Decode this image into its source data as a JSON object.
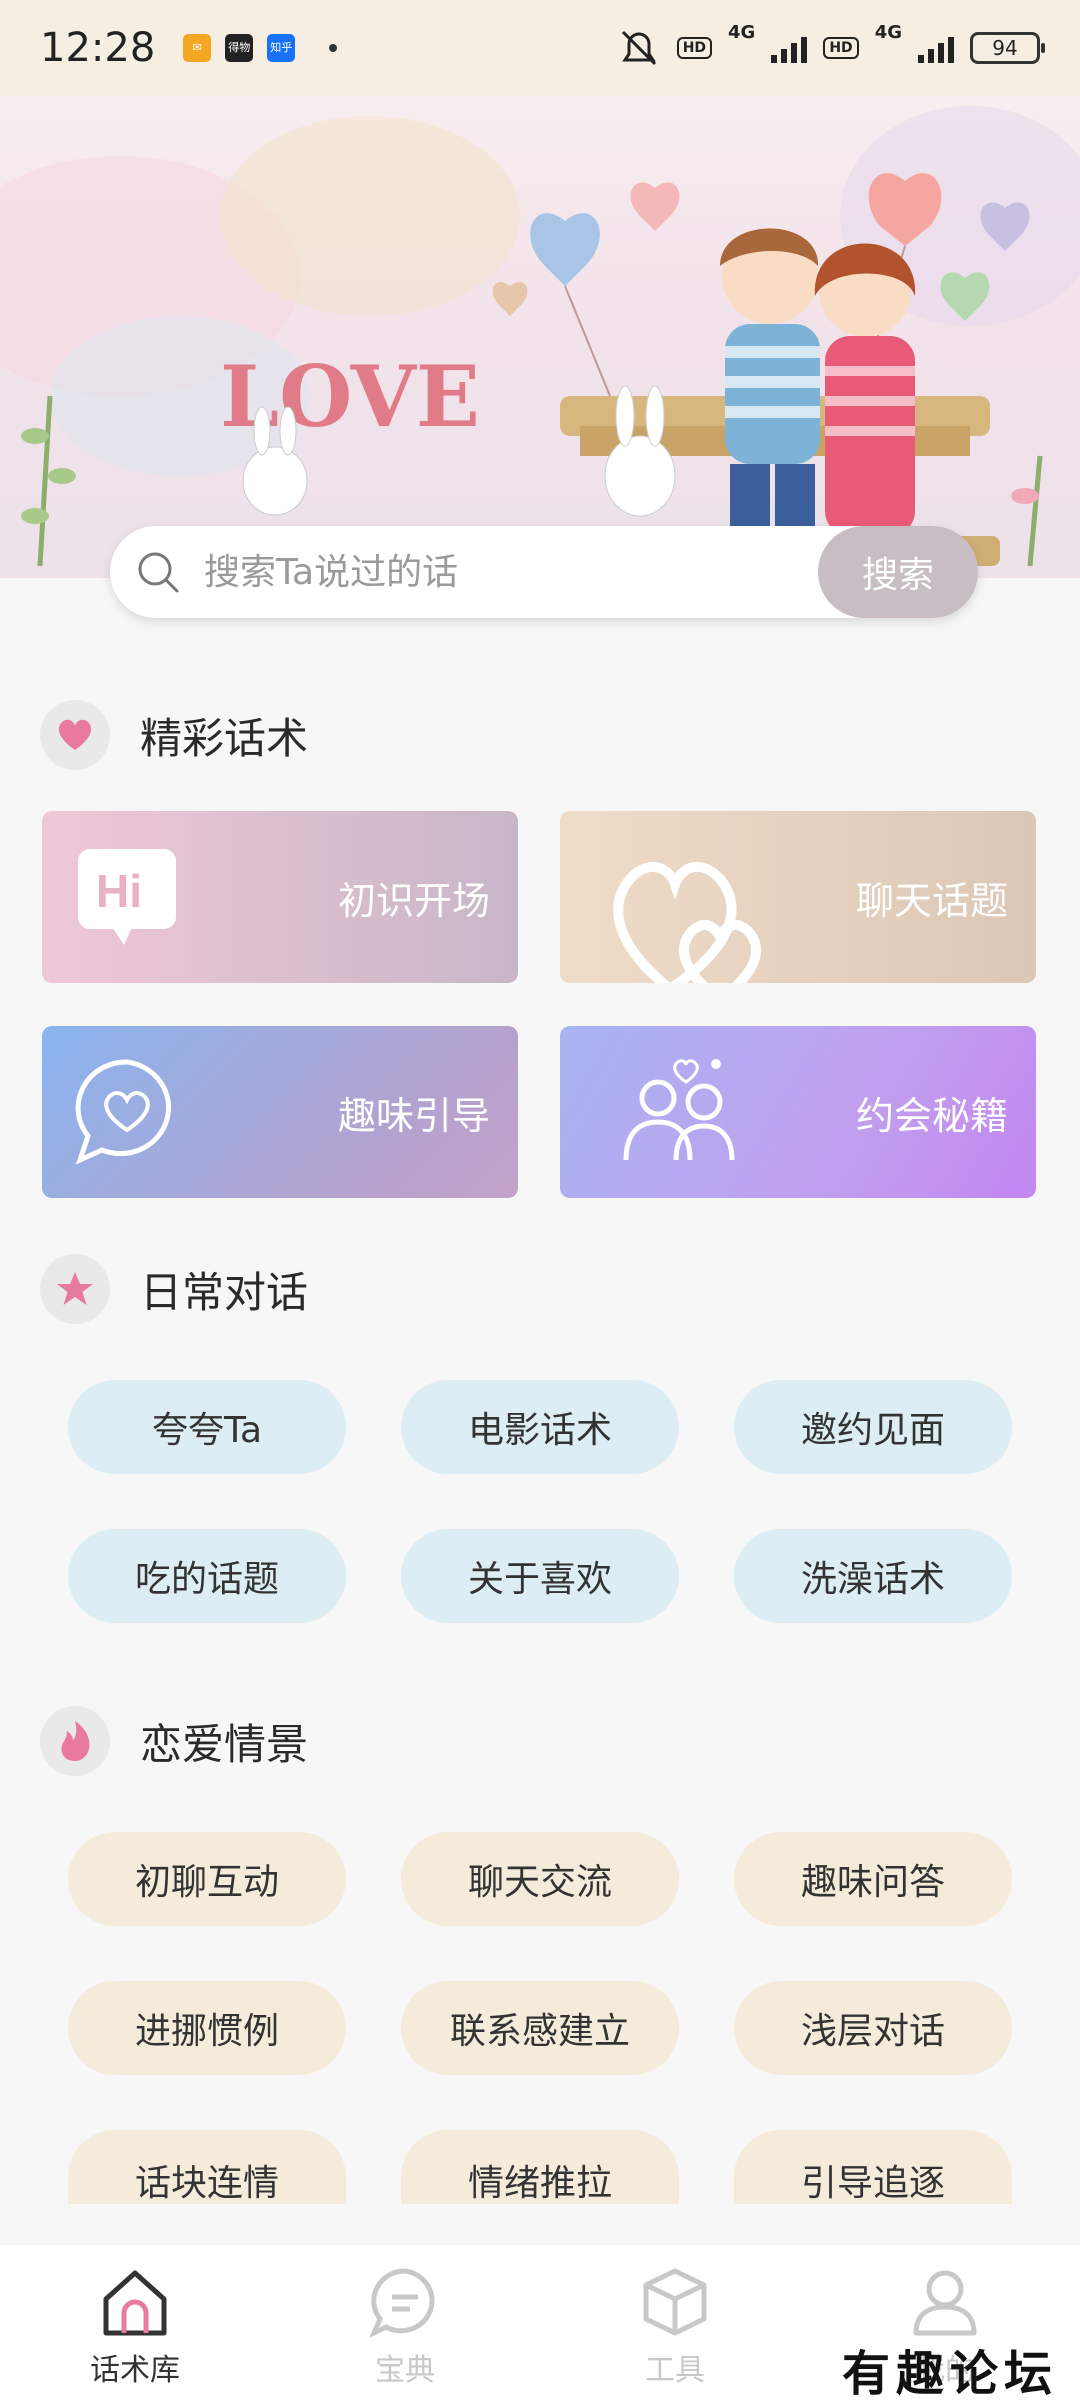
{
  "status_bar": {
    "time": "12:28",
    "mini_apps": [
      "得物",
      "知乎"
    ],
    "battery": "94",
    "net": "4G",
    "hd": "HD"
  },
  "search": {
    "placeholder": "搜索Ta说过的话",
    "button_label": "搜索"
  },
  "sections": {
    "featured": {
      "title": "精彩话术",
      "cards": [
        {
          "label": "初识开场",
          "icon": "hi-bubble-icon"
        },
        {
          "label": "聊天话题",
          "icon": "double-heart-icon"
        },
        {
          "label": "趣味引导",
          "icon": "heart-chat-icon"
        },
        {
          "label": "约会秘籍",
          "icon": "couple-icon"
        }
      ]
    },
    "daily": {
      "title": "日常对话",
      "icon": "star-icon",
      "tags": [
        "夸夸Ta",
        "电影话术",
        "邀约见面",
        "吃的话题",
        "关于喜欢",
        "洗澡话术"
      ]
    },
    "love": {
      "title": "恋爱情景",
      "icon": "flame-icon",
      "tags": [
        "初聊互动",
        "聊天交流",
        "趣味问答",
        "进挪惯例",
        "联系感建立",
        "浅层对话",
        "话块连情",
        "情绪推拉",
        "引导追逐"
      ]
    }
  },
  "nav": {
    "items": [
      {
        "label": "话术库",
        "icon": "home-icon",
        "active": true
      },
      {
        "label": "宝典",
        "icon": "chat-icon",
        "active": false
      },
      {
        "label": "工具",
        "icon": "box-icon",
        "active": false
      },
      {
        "label": "我的",
        "icon": "user-icon",
        "active": false
      }
    ]
  },
  "banner_text": "LOVE",
  "watermark": "有趣论坛",
  "colors": {
    "accent_pink": "#e87aa0",
    "pill_blue": "#dcedf4",
    "pill_beige": "#f5ebdb",
    "search_button": "#c7bdc2"
  }
}
